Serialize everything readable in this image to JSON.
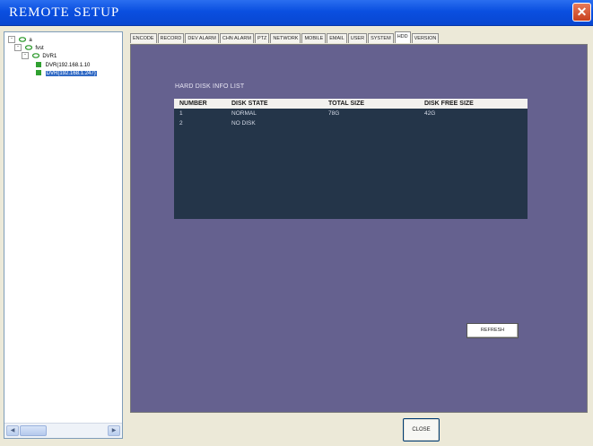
{
  "window": {
    "title": "REMOTE SETUP",
    "close_glyph": "✕"
  },
  "tree": {
    "nodes": [
      {
        "label": "a",
        "expander": "-"
      },
      {
        "label": "fvst",
        "expander": "-"
      },
      {
        "label": "DVR1",
        "expander": "-"
      },
      {
        "label": "DVR(192.168.1.10"
      },
      {
        "label": "DVR(192.168.1.247)"
      }
    ],
    "scroll_left": "◀",
    "scroll_right": "▶"
  },
  "tabs": [
    "ENCODE",
    "RECORD",
    "DEV ALARM",
    "CHN ALARM",
    "PTZ",
    "NETWORK",
    "MOBILE",
    "EMAIL",
    "USER",
    "SYSTEM",
    "HDD",
    "VERSION"
  ],
  "active_tab": "HDD",
  "hdd": {
    "section_title": "HARD DISK INFO LIST",
    "columns": [
      "NUMBER",
      "DISK STATE",
      "TOTAL SIZE",
      "DISK FREE SIZE"
    ],
    "rows": [
      [
        "1",
        "NORMAL",
        "78G",
        "42G"
      ],
      [
        "2",
        "NO DISK",
        "",
        ""
      ]
    ],
    "refresh_label": "REFRESH"
  },
  "footer": {
    "close_label": "CLOSE"
  },
  "colors": {
    "panel_bg": "#65618f",
    "table_bg": "#243549",
    "titlebar": "#0a4fe0",
    "selected": "#316ac5"
  }
}
